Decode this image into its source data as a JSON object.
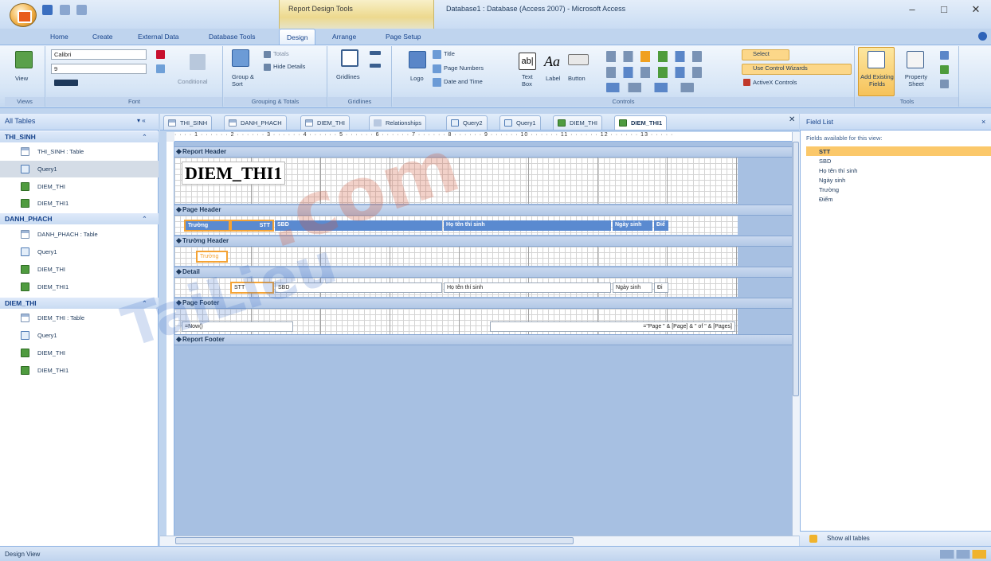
{
  "window": {
    "tools_context": "Report Design Tools",
    "title": "Database1 : Database (Access 2007) - Microsoft Access",
    "minimize": "–",
    "maximize": "□",
    "close": "✕"
  },
  "ribbon_tabs": [
    "Home",
    "Create",
    "External Data",
    "Database Tools",
    "Design",
    "Arrange",
    "Page Setup"
  ],
  "ribbon": {
    "views": {
      "label": "Views",
      "view_button": "View"
    },
    "font": {
      "label": "Font",
      "font_name": "Calibri",
      "font_size": "9",
      "conditional": "Conditional"
    },
    "grouping": {
      "label": "Grouping & Totals",
      "group_sort": "Group & Sort",
      "totals": "Totals",
      "hide_details": "Hide Details"
    },
    "gridlines": {
      "label": "Gridlines",
      "gridlines_button": "Gridlines"
    },
    "controls": {
      "label": "Controls",
      "logo": "Logo",
      "title": "Title",
      "page_numbers": "Page Numbers",
      "date_time": "Date and Time",
      "text_box": "Text Box",
      "label_button": "Label",
      "button": "Button",
      "select": "Select",
      "use_control_wizards": "Use Control Wizards",
      "activex": "ActiveX Controls"
    },
    "tools": {
      "label": "Tools",
      "add_existing_fields": "Add Existing Fields",
      "property_sheet": "Property Sheet"
    }
  },
  "nav": {
    "header": "All Tables",
    "groups": [
      {
        "name": "THI_SINH",
        "items": [
          {
            "label": "THI_SINH : Table",
            "icon": "table-icon"
          },
          {
            "label": "Query1",
            "icon": "query-icon"
          },
          {
            "label": "DIEM_THI",
            "icon": "report-icon"
          },
          {
            "label": "DIEM_THI1",
            "icon": "report-icon"
          }
        ]
      },
      {
        "name": "DANH_PHACH",
        "items": [
          {
            "label": "DANH_PHACH : Table",
            "icon": "table-icon"
          },
          {
            "label": "Query1",
            "icon": "query-icon"
          },
          {
            "label": "DIEM_THI",
            "icon": "report-icon"
          },
          {
            "label": "DIEM_THI1",
            "icon": "report-icon"
          }
        ]
      },
      {
        "name": "DIEM_THI",
        "items": [
          {
            "label": "DIEM_THI : Table",
            "icon": "table-icon"
          },
          {
            "label": "Query1",
            "icon": "query-icon"
          },
          {
            "label": "DIEM_THI",
            "icon": "report-icon"
          },
          {
            "label": "DIEM_THI1",
            "icon": "report-icon"
          }
        ]
      }
    ]
  },
  "doc_tabs": [
    "THI_SINH",
    "DANH_PHACH",
    "DIEM_THI",
    "Relationships",
    "Query2",
    "Query1",
    "DIEM_THI",
    "DIEM_THI1"
  ],
  "ruler_marks": "· · · · 1 · · · · · · 2 · · · · · · 3 · · · · · · 4 · · · · · · 5 · · · · · · 6 · · · · · · 7 · · · · · · 8 · · · · · · 9 · · · · · · 10 · · · · · · 11 · · · · · · 12 · · · · · · 13 · · · · ·",
  "sections": {
    "report_header": "Report Header",
    "page_header": "Page Header",
    "group_header": "Trường Header",
    "detail": "Detail",
    "page_footer": "Page Footer",
    "report_footer": "Report Footer"
  },
  "report": {
    "title": "DIEM_THI1",
    "page_header_labels": [
      "Trường",
      "STT",
      "SBD",
      "Họ tên thí sinh",
      "Ngày sinh",
      "Điể"
    ],
    "group_field": "Trường",
    "detail_fields": [
      "STT",
      "SBD",
      "Họ tên thí sinh",
      "Ngày sinh",
      "Đi"
    ],
    "footer_now": "=Now()",
    "footer_pages": "=\"Page \" & [Page] & \" of \" & [Pages]"
  },
  "field_list": {
    "header": "Field List",
    "caption": "Fields available for this view:",
    "fields": [
      "STT",
      "SBD",
      "Họ tên thí sinh",
      "Ngày sinh",
      "Trường",
      "Điểm"
    ],
    "selected": "STT",
    "show_all": "Show all tables"
  },
  "status": {
    "text": "Design View"
  },
  "watermark": {
    "text1": "TaiLieu",
    "text2": ".com"
  }
}
